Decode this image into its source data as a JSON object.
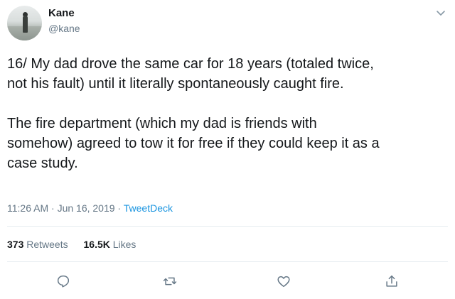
{
  "user": {
    "name": "Kane",
    "handle": "@kane"
  },
  "tweet": {
    "text": "16/ My dad drove the same car for 18 years (totaled twice,\nnot his fault) until it literally spontaneously caught fire.\n\nThe fire department (which my dad is friends with\nsomehow) agreed to tow it for free if they could keep it as a\ncase study.",
    "time": "11:26 AM",
    "date": "Jun 16, 2019",
    "source": "TweetDeck",
    "separator": " · "
  },
  "stats": {
    "retweets_count": "373",
    "retweets_label": "Retweets",
    "likes_count": "16.5K",
    "likes_label": "Likes"
  },
  "colors": {
    "text": "#14171a",
    "muted": "#657786",
    "link": "#1b95e0",
    "divider": "#e6ecf0",
    "icon": "#657786"
  },
  "icons": {
    "more": "chevron-down-icon",
    "reply": "reply-icon",
    "retweet": "retweet-icon",
    "like": "heart-icon",
    "share": "share-icon"
  }
}
